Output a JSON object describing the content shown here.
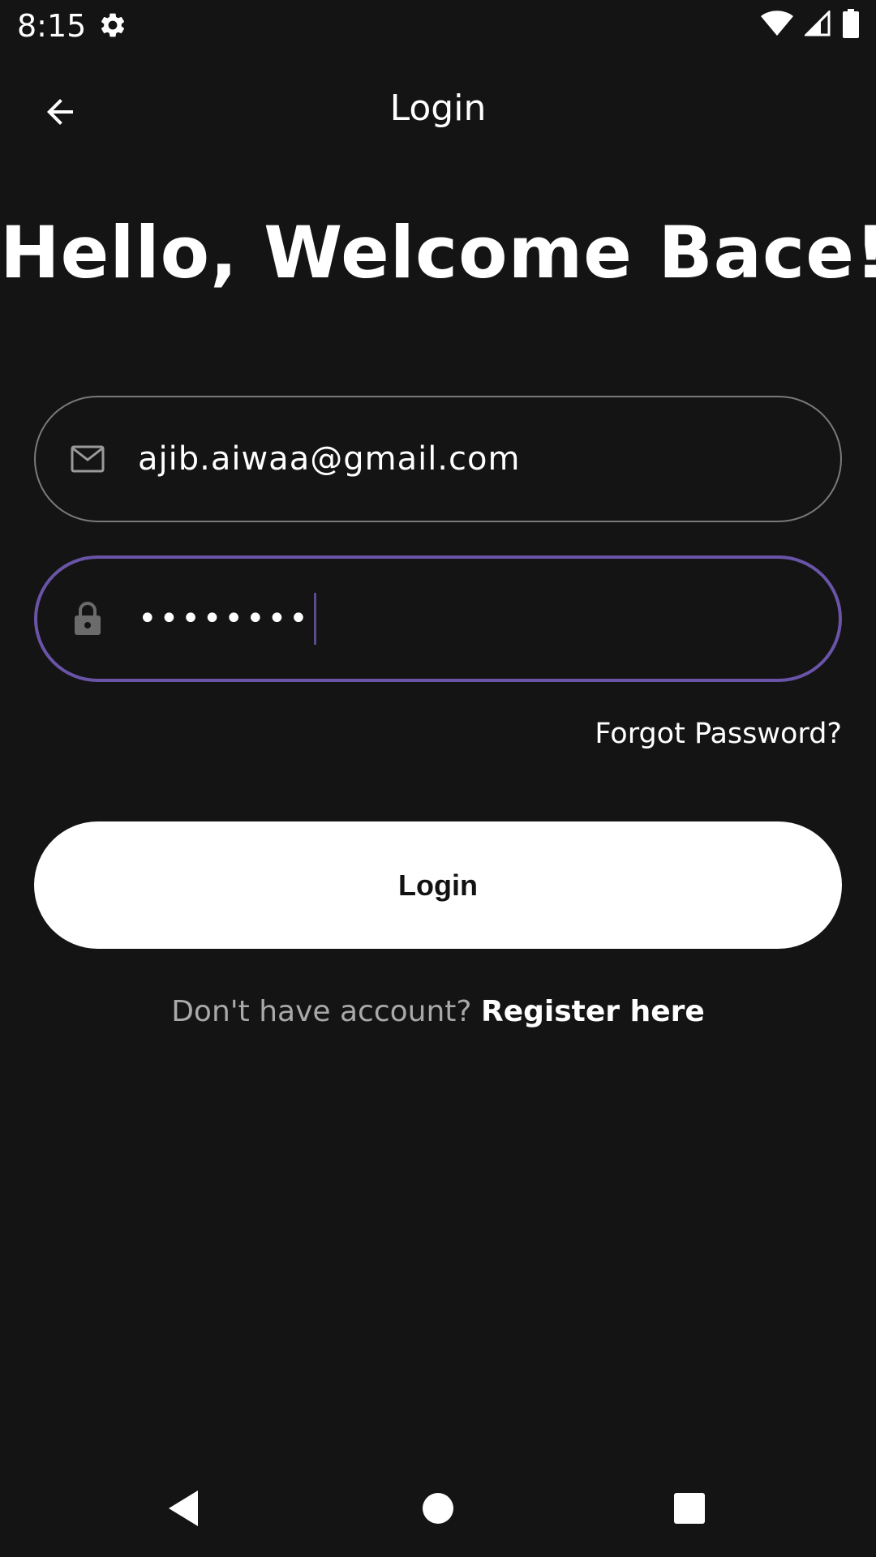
{
  "status_bar": {
    "time": "8:15",
    "icons": [
      "settings-gear-icon",
      "wifi-icon",
      "cellular-signal-icon",
      "battery-icon"
    ]
  },
  "app_bar": {
    "back_icon": "arrow-left-icon",
    "title": "Login"
  },
  "headline": "Hello, Welcome Bace!",
  "email_field": {
    "icon": "mail-icon",
    "value": "ajib.aiwaa@gmail.com"
  },
  "password_field": {
    "icon": "lock-icon",
    "value": "••••••••"
  },
  "forgot_password": "Forgot Password?",
  "login_button": "Login",
  "register": {
    "prompt": "Don't have account?",
    "link": "Register here"
  },
  "nav_bar": {
    "icons": [
      "nav-back-icon",
      "nav-home-icon",
      "nav-recents-icon"
    ]
  },
  "colors": {
    "background": "#141414",
    "focus_border": "#6a54a8",
    "field_border": "#7a7a7a",
    "button_bg": "#ffffff"
  }
}
